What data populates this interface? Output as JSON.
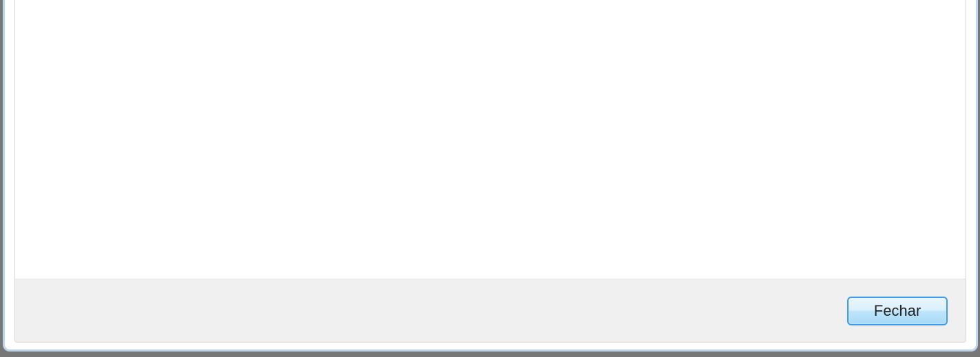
{
  "footer": {
    "close_label": "Fechar"
  }
}
